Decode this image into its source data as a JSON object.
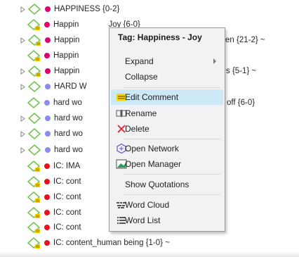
{
  "tree": {
    "rows": [
      {
        "label": "HAPPINESS {0-2}",
        "dot": "#e0006e",
        "expand": true
      },
      {
        "label": "Happiness - Joy {6-0}",
        "dot": "#e0006e",
        "expand": false
      },
      {
        "label": "Happiness - … {21-2} ~",
        "dot": "#e0006e",
        "expand": true
      },
      {
        "label": "Happiness",
        "dot": "#e0006e",
        "expand": false
      },
      {
        "label": "Happiness - … {5-1} ~",
        "dot": "#e0006e",
        "expand": true
      },
      {
        "label": "HARD WORK",
        "dot": "#8a8af0",
        "expand": true
      },
      {
        "label": "hard work - … off {6-0}",
        "dot": "#8a8af0",
        "expand": false
      },
      {
        "label": "hard work",
        "dot": "#8a8af0",
        "expand": true
      },
      {
        "label": "hard work",
        "dot": "#8a8af0",
        "expand": true
      },
      {
        "label": "hard work",
        "dot": "#8a8af0",
        "expand": true
      },
      {
        "label": "IC:  IMA",
        "dot": "#e8121b",
        "expand": false
      },
      {
        "label": "IC: content",
        "dot": "#e8121b",
        "expand": false
      },
      {
        "label": "IC: content",
        "dot": "#e8121b",
        "expand": false
      },
      {
        "label": "IC: content",
        "dot": "#e8121b",
        "expand": false
      },
      {
        "label": "IC: content",
        "dot": "#e8121b",
        "expand": false
      },
      {
        "label": "IC: content_human being {1-0} ~",
        "dot": "#e8121b",
        "expand": false
      }
    ],
    "visible_texts": [
      "HAPPINESS {0-2}",
      "Happin",
      "Joy {6-0}",
      "Happin",
      "en {21-2} ~",
      "Happin",
      "Happin",
      "s {5-1} ~",
      "HARD W",
      "hard wo",
      "off {6-0}",
      "hard wo",
      "hard wo",
      "hard wo",
      "IC:  IMA",
      "IC: cont",
      "IC: cont",
      "IC: cont",
      "IC: cont",
      "IC: content_human being {1-0} ~"
    ]
  },
  "context_menu": {
    "title": "Tag: Happiness - Joy",
    "items": [
      {
        "label": "Expand",
        "icon": "none",
        "submenu": true
      },
      {
        "label": "Collapse",
        "icon": "none"
      },
      {
        "label": "Edit Comment",
        "icon": "comment-icon",
        "highlighted": true
      },
      {
        "label": "Rename",
        "icon": "rename-icon"
      },
      {
        "label": "Delete",
        "icon": "delete-icon"
      },
      {
        "label": "Open Network",
        "icon": "network-icon"
      },
      {
        "label": "Open Manager",
        "icon": "manager-icon"
      },
      {
        "label": "Show Quotations",
        "icon": "none"
      },
      {
        "label": "Word Cloud",
        "icon": "word-cloud-icon"
      },
      {
        "label": "Word List",
        "icon": "word-list-icon"
      }
    ]
  },
  "colors": {
    "happiness": "#e0006e",
    "hard_work": "#8a8af0",
    "ic": "#e8121b",
    "diamond": "#6fc24a",
    "highlight": "#cde8f7",
    "comment_note": "#f5d300"
  }
}
